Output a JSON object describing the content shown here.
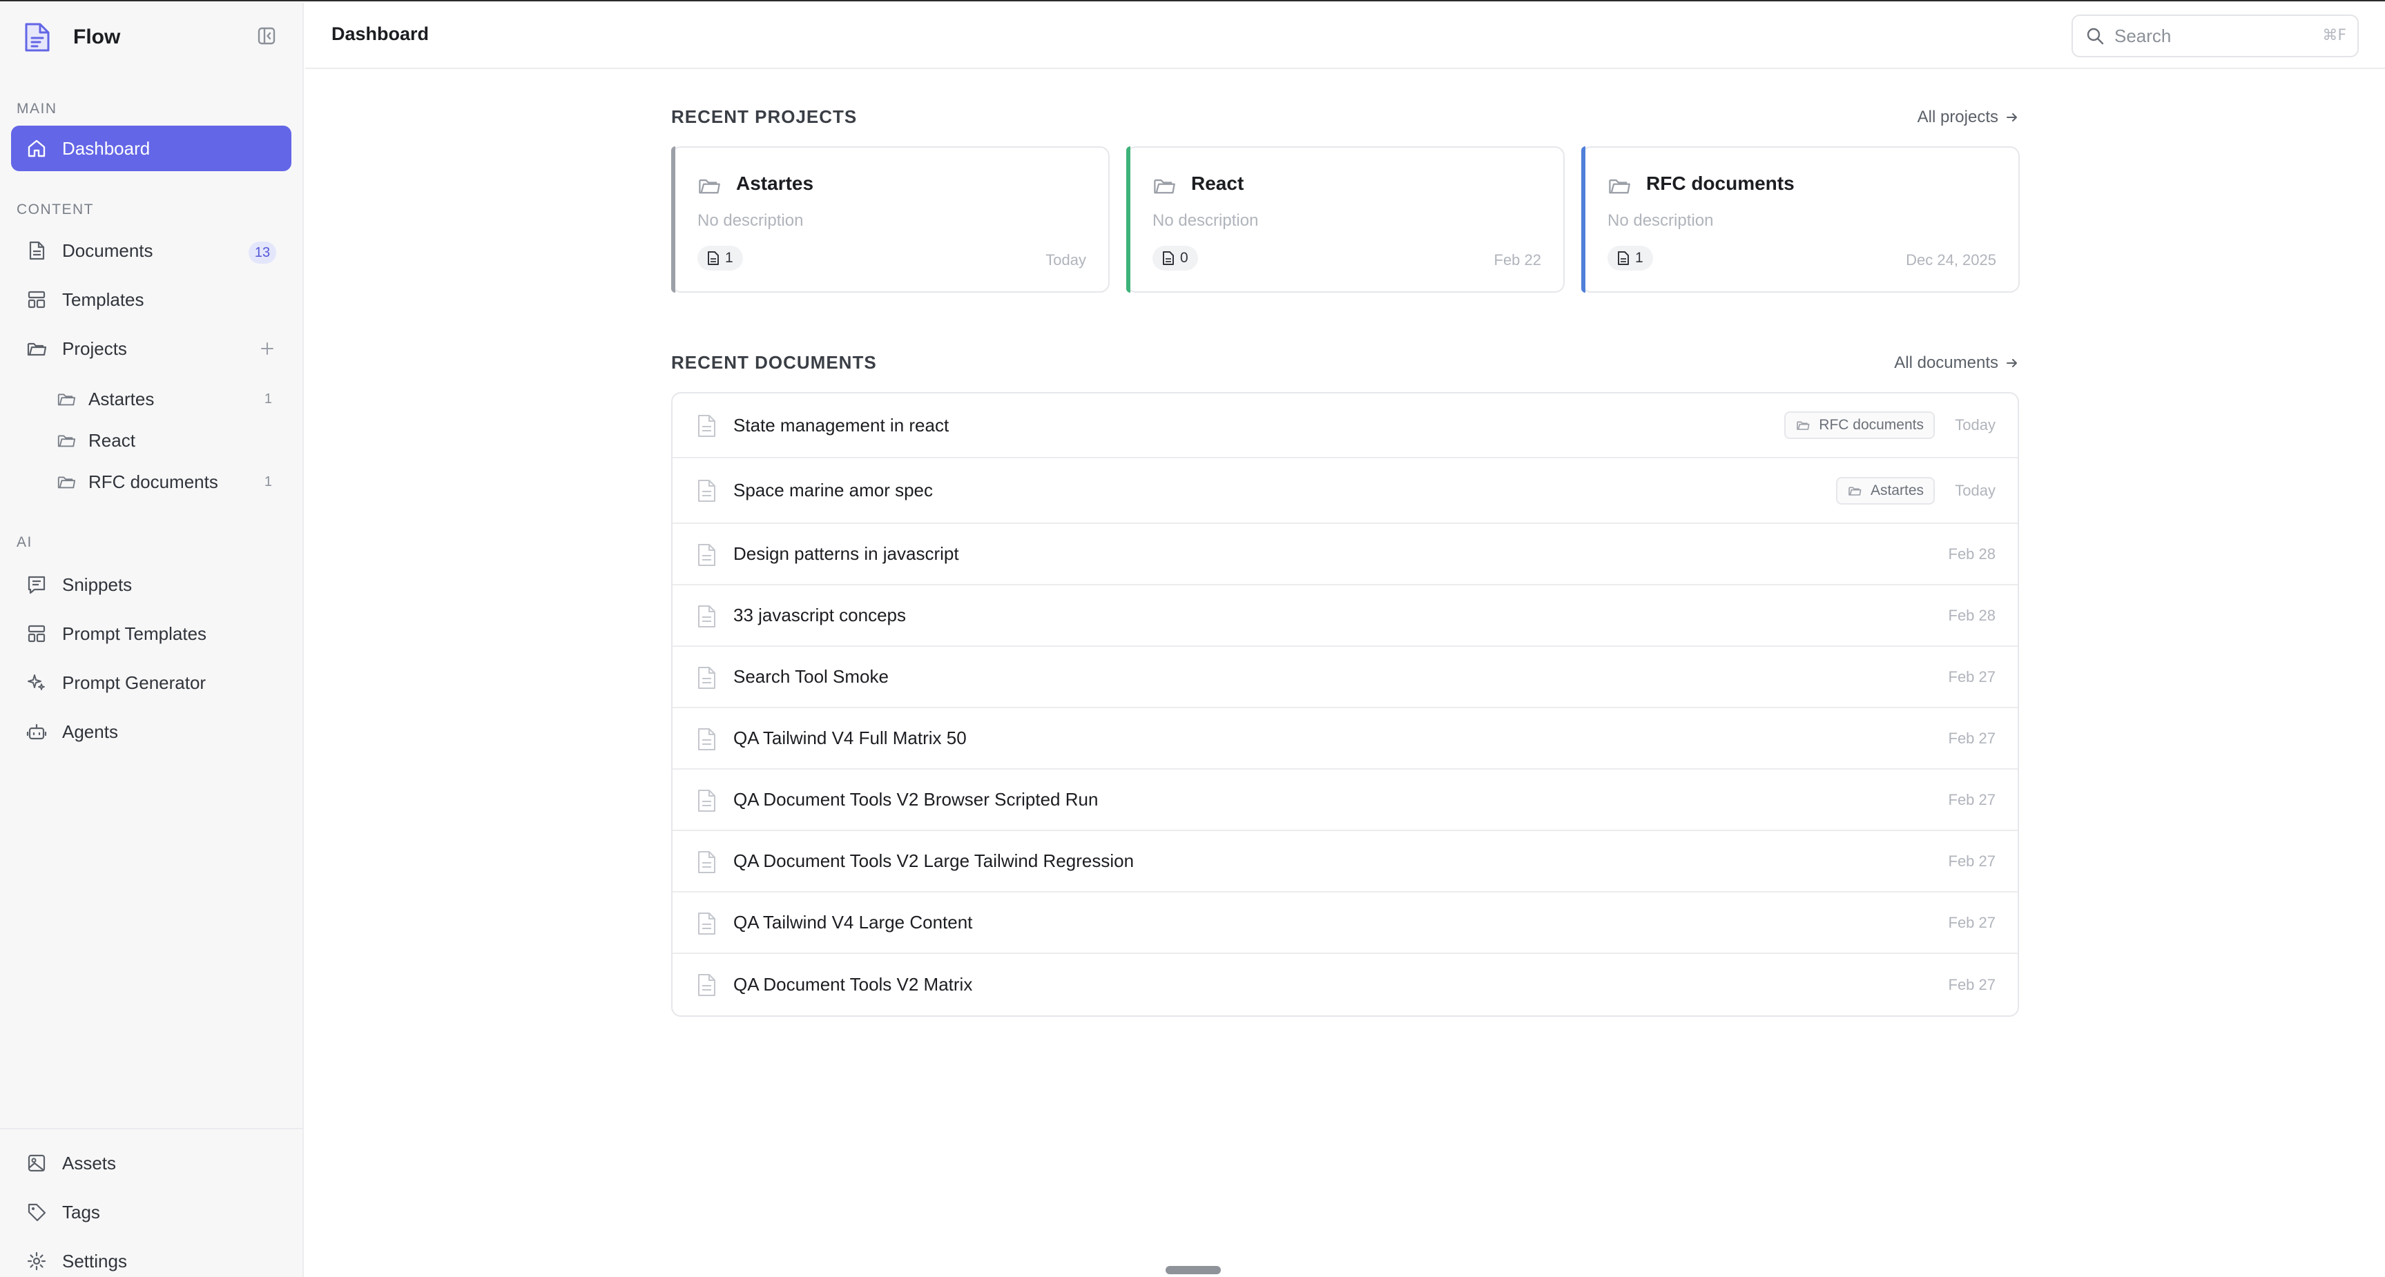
{
  "app": {
    "name": "Flow"
  },
  "header": {
    "title": "Dashboard"
  },
  "search": {
    "placeholder": "Search",
    "shortcut": "⌘F"
  },
  "sidebar": {
    "sections": {
      "main": "MAIN",
      "content": "CONTENT",
      "ai": "AI"
    },
    "main_items": [
      {
        "label": "Dashboard",
        "icon": "home-icon"
      }
    ],
    "content_items": [
      {
        "label": "Documents",
        "icon": "document-icon",
        "badge": "13"
      },
      {
        "label": "Templates",
        "icon": "layout-icon"
      },
      {
        "label": "Projects",
        "icon": "folder-icon"
      }
    ],
    "projects": [
      {
        "label": "Astartes",
        "count": "1"
      },
      {
        "label": "React",
        "count": ""
      },
      {
        "label": "RFC documents",
        "count": "1"
      }
    ],
    "ai_items": [
      {
        "label": "Snippets",
        "icon": "snippet-icon"
      },
      {
        "label": "Prompt Templates",
        "icon": "layout-icon"
      },
      {
        "label": "Prompt Generator",
        "icon": "sparkles-icon"
      },
      {
        "label": "Agents",
        "icon": "bot-icon"
      }
    ],
    "bottom_items": [
      {
        "label": "Assets",
        "icon": "image-icon"
      },
      {
        "label": "Tags",
        "icon": "tag-icon"
      },
      {
        "label": "Settings",
        "icon": "gear-icon"
      }
    ]
  },
  "recent_projects": {
    "title": "RECENT PROJECTS",
    "link": "All projects",
    "items": [
      {
        "name": "Astartes",
        "description": "No description",
        "count": "1",
        "date": "Today",
        "color": "#9ca0a8"
      },
      {
        "name": "React",
        "description": "No description",
        "count": "0",
        "date": "Feb 22",
        "color": "#3db37a"
      },
      {
        "name": "RFC documents",
        "description": "No description",
        "count": "1",
        "date": "Dec 24, 2025",
        "color": "#4f7fd9"
      }
    ]
  },
  "recent_documents": {
    "title": "RECENT DOCUMENTS",
    "link": "All documents",
    "items": [
      {
        "title": "State management in react",
        "project": "RFC documents",
        "date": "Today"
      },
      {
        "title": "Space marine amor spec",
        "project": "Astartes",
        "date": "Today"
      },
      {
        "title": "Design patterns in javascript",
        "project": "",
        "date": "Feb 28"
      },
      {
        "title": "33 javascript conceps",
        "project": "",
        "date": "Feb 28"
      },
      {
        "title": "Search Tool Smoke",
        "project": "",
        "date": "Feb 27"
      },
      {
        "title": "QA Tailwind V4 Full Matrix 50",
        "project": "",
        "date": "Feb 27"
      },
      {
        "title": "QA Document Tools V2 Browser Scripted Run",
        "project": "",
        "date": "Feb 27"
      },
      {
        "title": "QA Document Tools V2 Large Tailwind Regression",
        "project": "",
        "date": "Feb 27"
      },
      {
        "title": "QA Tailwind V4 Large Content",
        "project": "",
        "date": "Feb 27"
      },
      {
        "title": "QA Document Tools V2 Matrix",
        "project": "",
        "date": "Feb 27"
      }
    ]
  },
  "colors": {
    "accent": "#6366e6",
    "accent_light": "#e4e6fb",
    "border": "#e6e7eb",
    "muted_text": "#b0b4bb"
  }
}
